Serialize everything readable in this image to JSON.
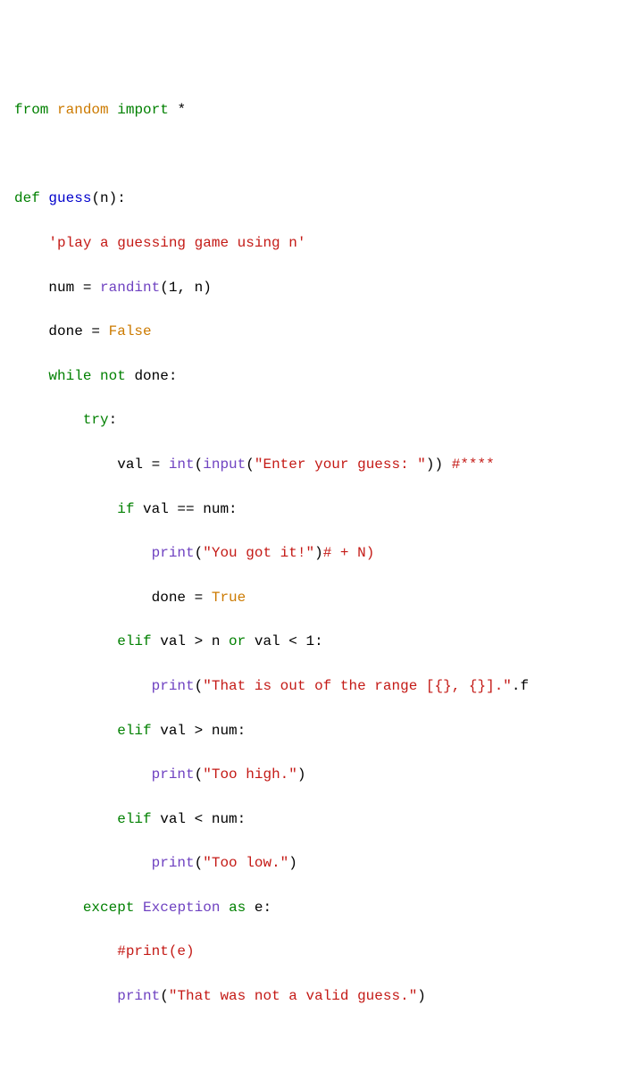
{
  "code": {
    "l1": {
      "kw_from": "from",
      "mod": "random",
      "kw_import": "import",
      "star": "*"
    },
    "l3": {
      "kw_def": "def",
      "fn": "guess",
      "params": "(n):"
    },
    "l4": {
      "doc": "'play a guessing game using n'"
    },
    "l5": {
      "lhs": "num = ",
      "call": "randint",
      "args": "(1, n)"
    },
    "l6": {
      "lhs": "done = ",
      "val": "False"
    },
    "l7": {
      "kw_while": "while",
      "kw_not": "not",
      "rest": " done:"
    },
    "l8": {
      "kw_try": "try",
      "colon": ":"
    },
    "l9": {
      "lhs": "val = ",
      "call_int": "int",
      "p1": "(",
      "call_input": "input",
      "p2": "(",
      "str": "\"Enter your guess: \"",
      "p3": "))",
      "space": " ",
      "com": "#****"
    },
    "l10": {
      "kw_if": "if",
      "rest": " val == num:"
    },
    "l11": {
      "call": "print",
      "p1": "(",
      "str": "\"You got it!\"",
      "p2": ")",
      "com": "# + N)"
    },
    "l12": {
      "lhs": "done = ",
      "val": "True"
    },
    "l13": {
      "kw_elif": "elif",
      "cond": " val > n ",
      "kw_or": "or",
      "cond2": " val < 1:"
    },
    "l14": {
      "call": "print",
      "p1": "(",
      "str": "\"That is out of the range [{}, {}].\"",
      "p2": ".f"
    },
    "l15": {
      "kw_elif": "elif",
      "rest": " val > num:"
    },
    "l16": {
      "call": "print",
      "p1": "(",
      "str": "\"Too high.\"",
      "p2": ")"
    },
    "l17": {
      "kw_elif": "elif",
      "rest": " val < num:"
    },
    "l18": {
      "call": "print",
      "p1": "(",
      "str": "\"Too low.\"",
      "p2": ")"
    },
    "l19": {
      "kw_except": "except",
      "sp": " ",
      "exc": "Exception",
      "kw_as": "as",
      "rest": " e:"
    },
    "l20": {
      "com": "#print(e)"
    },
    "l21": {
      "call": "print",
      "p1": "(",
      "str": "\"That was not a valid guess.\"",
      "p2": ")"
    }
  }
}
